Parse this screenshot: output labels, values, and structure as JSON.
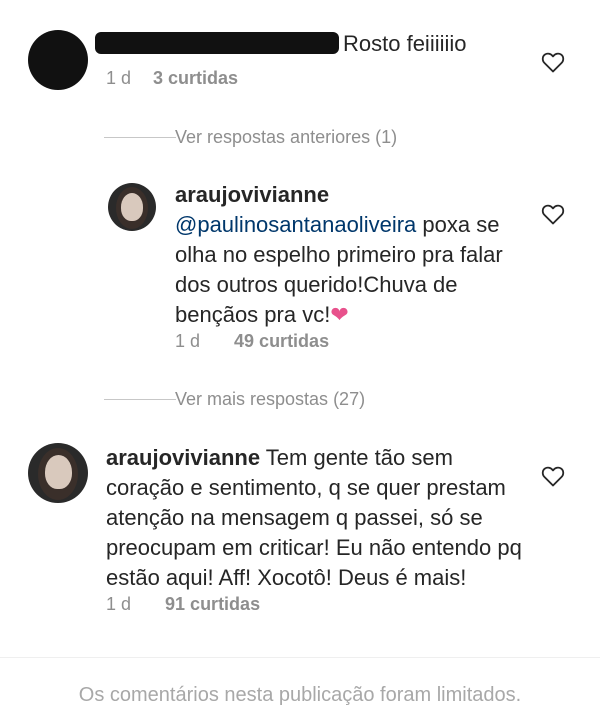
{
  "comments": [
    {
      "username": "",
      "text": "Rosto feiiiiiio",
      "time": "1 d",
      "likes": "3 curtidas"
    }
  ],
  "replies_block_1": {
    "view_previous": "Ver respostas anteriores (1)",
    "reply": {
      "username": "araujovivianne",
      "mention": "@paulinosantanaoliveira",
      "text_after_mention": " poxa se olha no espelho primeiro pra falar dos outros querido!Chuva de bençãos pra vc!",
      "emoji": "❤",
      "time": "1 d",
      "likes": "49 curtidas"
    },
    "view_more": "Ver mais respostas (27)"
  },
  "comment_2": {
    "username": "araujovivianne",
    "text": " Tem gente tão sem coração e sentimento, q se quer prestam atenção na mensagem q passei, só se preocupam em criticar!  Eu não entendo pq estão aqui! Aff! Xocotô! Deus é mais!",
    "time": "1 d",
    "likes": "91 curtidas"
  },
  "footer": {
    "limited_notice": "Os comentários nesta publicação foram limitados."
  },
  "colors": {
    "text": "#262626",
    "secondary": "#8e8e8e",
    "mention": "#00376b",
    "heart_emoji": "#e8518c"
  }
}
